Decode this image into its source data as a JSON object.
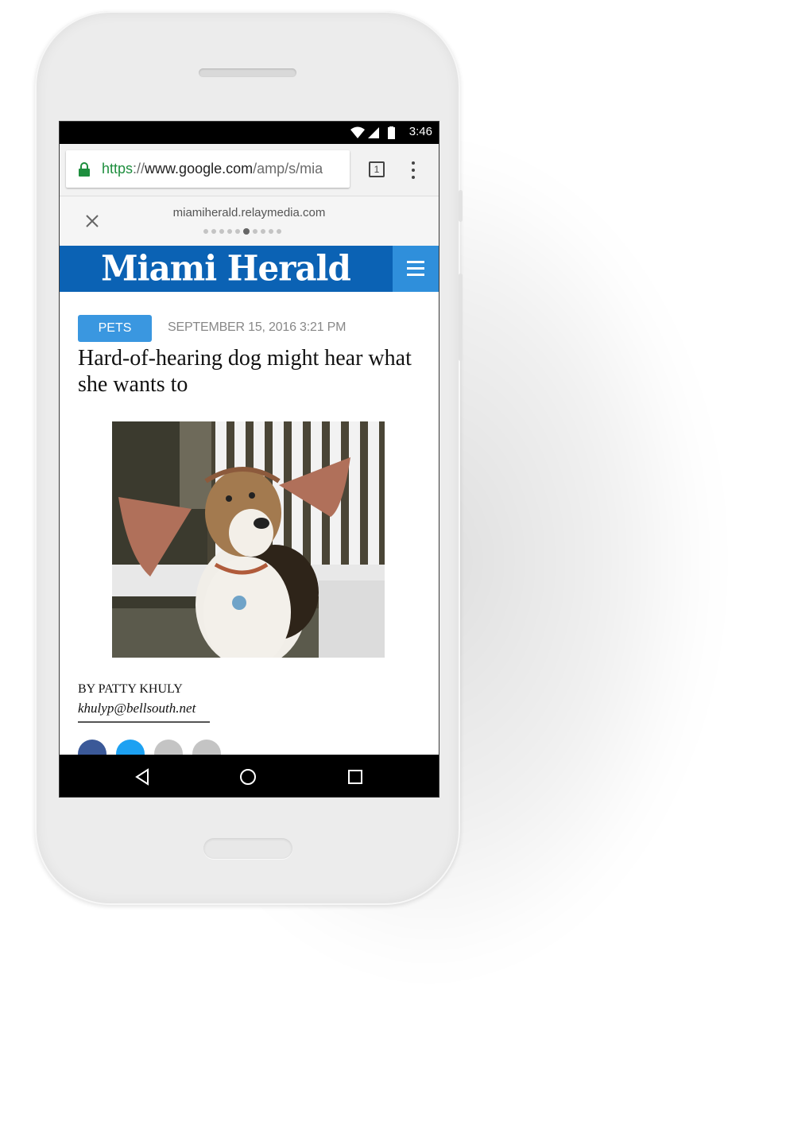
{
  "status_bar": {
    "time": "3:46"
  },
  "browser": {
    "url": {
      "scheme": "https",
      "separator": "://",
      "host": "www.google.com",
      "path": "/amp/s/mia"
    },
    "tab_count": "1"
  },
  "amp_viewer": {
    "domain": "miamiherald.relaymedia.com",
    "page_dots": 10,
    "active_dot": 6
  },
  "site": {
    "logo_text": "Miami Herald",
    "brand_color": "#0b62b4"
  },
  "article": {
    "category": "PETS",
    "date": "SEPTEMBER 15, 2016 3:21 PM",
    "headline": "Hard-of-hearing dog might hear what she wants to",
    "byline": "BY PATTY KHULY",
    "email": "khulyp@bellsouth.net",
    "share": [
      "facebook-icon",
      "twitter-icon",
      "email-icon",
      "share-icon"
    ]
  },
  "colors": {
    "accent": "#3a97e0",
    "https": "#1e8e3e",
    "facebook": "#3b5998",
    "twitter": "#1da1f2"
  }
}
